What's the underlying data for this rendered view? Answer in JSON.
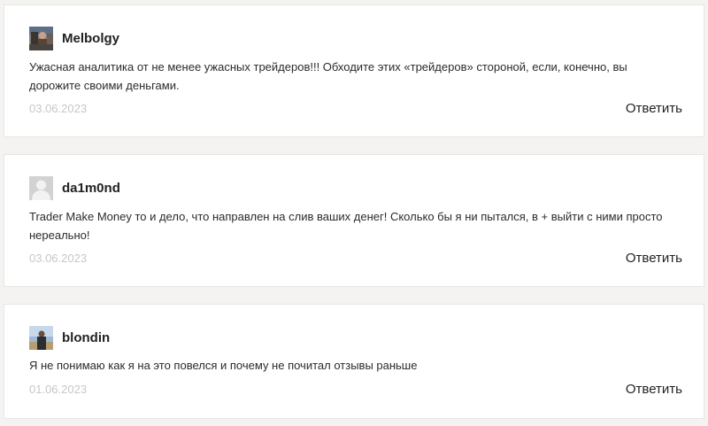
{
  "comments": [
    {
      "author": "Melbolgy",
      "text": "Ужасная аналитика от не менее ужасных трейдеров!!! Обходите этих «трейдеров» стороной, если, конечно, вы дорожите своими деньгами.",
      "date": "03.06.2023",
      "reply_label": "Ответить",
      "avatar": "photo-avatar-icon"
    },
    {
      "author": "da1m0nd",
      "text": "Trader Make Money то и дело, что направлен на слив ваших денег! Сколько бы я ни пытался, в + выйти с ними просто нереально!",
      "date": "03.06.2023",
      "reply_label": "Ответить",
      "avatar": "default-user-icon"
    },
    {
      "author": "blondin",
      "text": "Я не понимаю как я на это повелся и почему не почитал отзывы раньше",
      "date": "01.06.2023",
      "reply_label": "Ответить",
      "avatar": "photo-avatar-icon"
    }
  ]
}
